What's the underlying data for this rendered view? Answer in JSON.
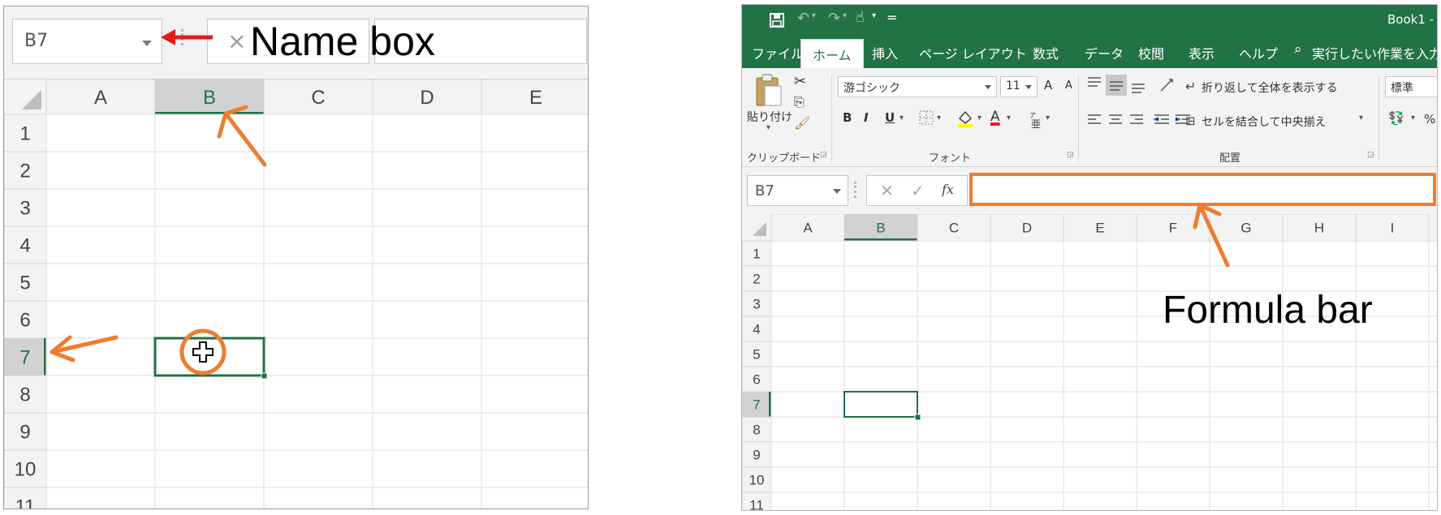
{
  "left_panel": {
    "name_box": {
      "value": "B7"
    },
    "formula_cancel_icon": "×",
    "columns": [
      "A",
      "B",
      "C",
      "D",
      "E"
    ],
    "rows": [
      "1",
      "2",
      "3",
      "4",
      "5",
      "6",
      "7",
      "8",
      "9",
      "10",
      "11"
    ],
    "selected_cell": {
      "column": "B",
      "row": "7"
    },
    "annotation": {
      "label": "Name box"
    }
  },
  "right_panel": {
    "title": "Book1 -",
    "quick_access": {
      "save_icon": "save-icon",
      "undo_icon": "undo-icon",
      "redo_icon": "redo-icon",
      "touch_icon": "touch-mode-icon",
      "customize": "="
    },
    "tabs": [
      "ファイル",
      "ホーム",
      "挿入",
      "ページ レイアウト",
      "数式",
      "データ",
      "校閲",
      "表示",
      "ヘルプ"
    ],
    "active_tab": "ホーム",
    "tell_me": "実行したい作業を入力し",
    "ribbon": {
      "clipboard": {
        "paste_label": "貼り付け",
        "group_label": "クリップボード"
      },
      "font": {
        "font_name": "游ゴシック",
        "font_size": "11",
        "grow": "A",
        "shrink": "A",
        "bold": "B",
        "italic": "I",
        "underline": "U",
        "font_color_glyph": "A",
        "group_label": "フォント"
      },
      "alignment": {
        "wrap_text": "折り返して全体を表示する",
        "merge_center": "セルを結合して中央揃え",
        "group_label": "配置"
      },
      "number": {
        "format": "標準",
        "percent": "%"
      }
    },
    "formula_bar": {
      "name_box": "B7",
      "fx_label": "fx",
      "value": ""
    },
    "columns": [
      "A",
      "B",
      "C",
      "D",
      "E",
      "F",
      "G",
      "H",
      "I"
    ],
    "rows": [
      "1",
      "2",
      "3",
      "4",
      "5",
      "6",
      "7",
      "8",
      "9",
      "10",
      "11"
    ],
    "selected_cell": {
      "column": "B",
      "row": "7"
    },
    "annotation": {
      "label": "Formula bar"
    }
  },
  "colors": {
    "excel_green": "#217346",
    "annotation_orange": "#ee7d31",
    "annotation_red": "#e51b1b",
    "selection_green": "#1e7145"
  }
}
